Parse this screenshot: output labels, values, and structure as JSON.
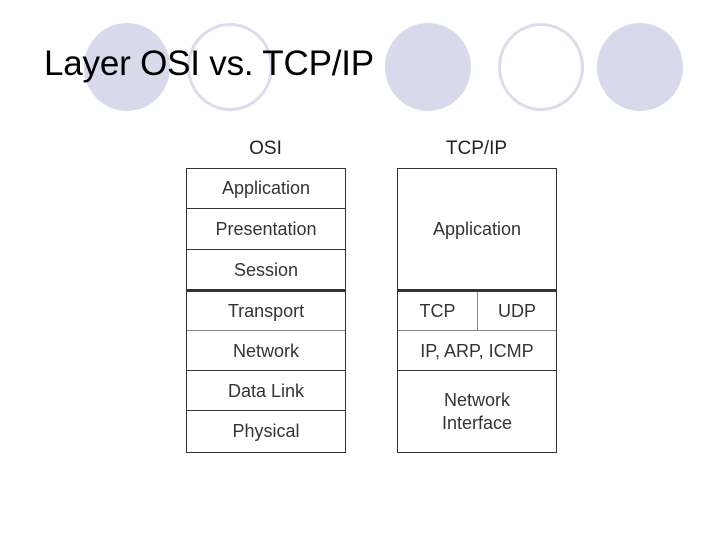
{
  "slide": {
    "title": "Layer OSI vs. TCP/IP",
    "decoration": {
      "circle_fill_color": "#d9d9ec",
      "circle_outline_color": "#dcdcec",
      "circles": [
        "filled",
        "outline",
        "filled",
        "outline",
        "filled"
      ]
    }
  },
  "osi": {
    "label": "OSI",
    "layers": [
      "Application",
      "Presentation",
      "Session",
      "Transport",
      "Network",
      "Data Link",
      "Physical"
    ]
  },
  "tcpip": {
    "label": "TCP/IP",
    "application": "Application",
    "transport_left": "TCP",
    "transport_right": "UDP",
    "internet": "IP, ARP, ICMP",
    "network_interface_line1": "Network",
    "network_interface_line2": "Interface"
  }
}
